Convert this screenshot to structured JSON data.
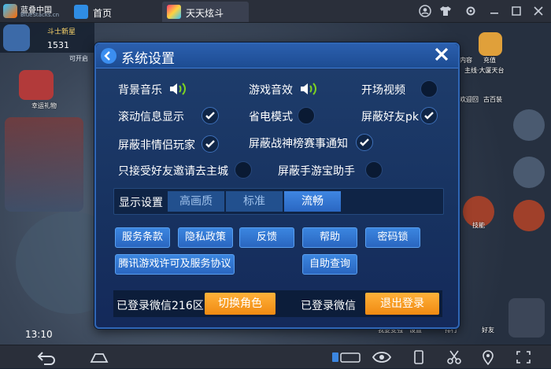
{
  "emulator": {
    "brand": "蓝叠中国",
    "brand_sub": "BlueStacks.cn",
    "tabs": [
      {
        "label": "首页",
        "icon": "home-icon"
      },
      {
        "label": "天天炫斗",
        "icon": "game-app-icon"
      }
    ],
    "window_controls": [
      "account-icon",
      "shirt-icon",
      "settings-icon",
      "minimize-icon",
      "maximize-icon",
      "close-icon"
    ]
  },
  "game": {
    "player_title": "斗士新星",
    "player_score": "1531",
    "mini_text": "可开启",
    "left_label": "幸运礼物",
    "clock": "13:10",
    "right_labels": [
      "内容",
      "充值",
      "主线·大厦天台",
      "欢迎回",
      "古百装",
      "技能",
      "我要变强",
      "设置",
      "排行",
      "好友"
    ]
  },
  "dialog": {
    "title": "系统设置",
    "options": {
      "bg_music": {
        "label": "背景音乐",
        "state": "on"
      },
      "game_sfx": {
        "label": "游戏音效",
        "state": "on"
      },
      "intro_video": {
        "label": "开场视频",
        "checked": false
      },
      "scroll_info": {
        "label": "滚动信息显示",
        "checked": true
      },
      "power_save": {
        "label": "省电模式",
        "checked": false
      },
      "block_friend_pk": {
        "label": "屏蔽好友pk",
        "checked": true
      },
      "block_non_partner": {
        "label": "屏蔽非情侣玩家",
        "checked": true
      },
      "block_ranking": {
        "label": "屏蔽战神榜赛事通知",
        "checked": true
      },
      "friend_invite_only": {
        "label": "只接受好友邀请去主城",
        "checked": false
      },
      "block_assistant": {
        "label": "屏蔽手游宝助手",
        "checked": false
      }
    },
    "quality": {
      "label": "显示设置",
      "tabs": [
        "高画质",
        "标准",
        "流畅"
      ],
      "selected": "流畅"
    },
    "buttons": {
      "terms": "服务条款",
      "privacy": "隐私政策",
      "feedback": "反馈",
      "help": "帮助",
      "lock": "密码锁",
      "tencent_license": "腾讯游戏许可及服务协议",
      "self_query": "自助查询"
    },
    "account": {
      "login_zone": "已登录微信216区",
      "switch_role": "切换角色",
      "login_wechat": "已登录微信",
      "logout": "退出登录"
    }
  },
  "colors": {
    "dialog_bg": "#1a3565",
    "accent_blue": "#3b86e0",
    "accent_orange": "#f39a1c",
    "sound_green": "#7ed321"
  },
  "navbar": [
    "back-icon",
    "home-icon",
    "keyboard-icon",
    "eye-icon",
    "phone-icon",
    "scissors-icon",
    "location-icon",
    "fullscreen-icon"
  ]
}
